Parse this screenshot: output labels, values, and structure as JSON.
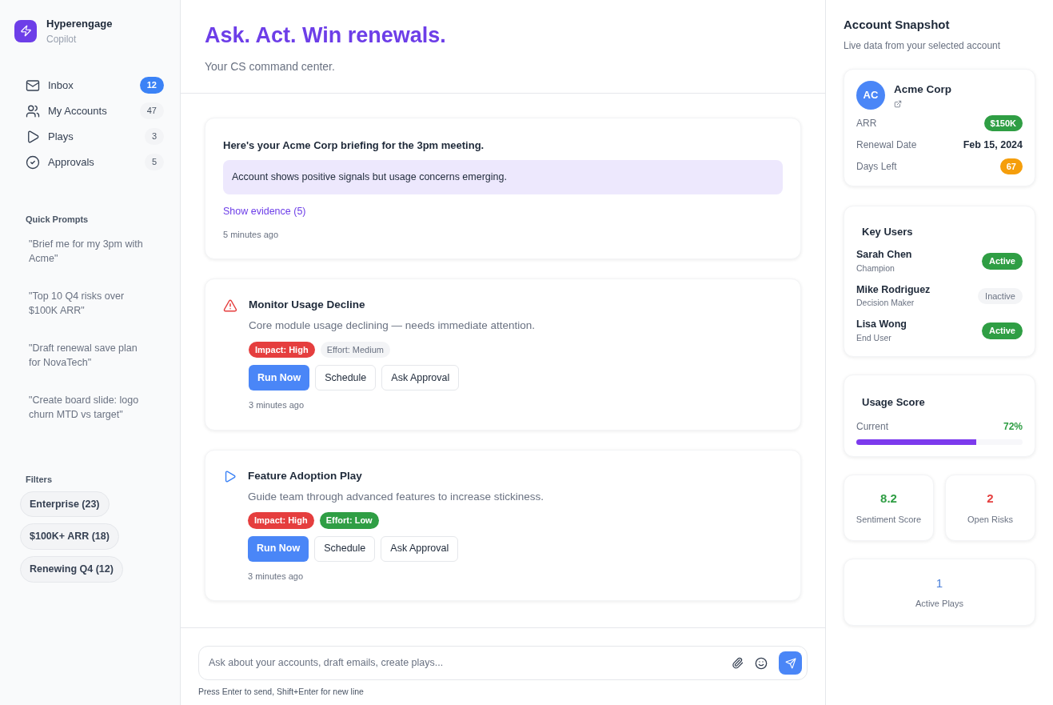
{
  "brand": {
    "name": "Hyperengage",
    "subtitle": "Copilot"
  },
  "nav": [
    {
      "label": "Inbox",
      "count": "12",
      "kind": "mail",
      "selected": true
    },
    {
      "label": "My Accounts",
      "count": "47",
      "kind": "users",
      "selected": false
    },
    {
      "label": "Plays",
      "count": "3",
      "kind": "play",
      "selected": false
    },
    {
      "label": "Approvals",
      "count": "5",
      "kind": "check",
      "selected": false
    }
  ],
  "quick_prompts": {
    "title": "Quick Prompts",
    "items": [
      "\"Brief me for my 3pm with Acme\"",
      "\"Top 10 Q4 risks over $100K ARR\"",
      "\"Draft renewal save plan for NovaTech\"",
      "\"Create board slide: logo churn MTD vs target\""
    ]
  },
  "filters": {
    "title": "Filters",
    "items": [
      "Enterprise (23)",
      "$100K+ ARR (18)",
      "Renewing Q4 (12)"
    ]
  },
  "header": {
    "title": "Ask. Act. Win renewals.",
    "subtitle": "Your CS command center."
  },
  "briefing": {
    "title": "Here's your Acme Corp briefing for the 3pm meeting.",
    "summary": "Account shows positive signals but usage concerns emerging.",
    "link": "Show evidence (5)",
    "time": "5 minutes ago"
  },
  "actions": [
    {
      "kind": "alert",
      "title": "Monitor Usage Decline",
      "description": "Core module usage declining — needs immediate attention.",
      "tags": [
        {
          "label": "Impact: High",
          "color": "#e53e3e"
        },
        {
          "label": "Effort: Medium",
          "color": "#f3f4f6"
        }
      ],
      "buttons": [
        "Run Now",
        "Schedule",
        "Ask Approval"
      ],
      "time": "3 minutes ago"
    },
    {
      "kind": "play",
      "title": "Feature Adoption Play",
      "description": "Guide team through advanced features to increase stickiness.",
      "tags": [
        {
          "label": "Impact: High",
          "color": "#e53e3e"
        },
        {
          "label": "Effort: Low",
          "color": "#2f9e44"
        }
      ],
      "buttons": [
        "Run Now",
        "Schedule",
        "Ask Approval"
      ],
      "time": "3 minutes ago"
    }
  ],
  "composer": {
    "placeholder": "Ask about your accounts, draft emails, create plays...",
    "hint": "Press Enter to send, Shift+Enter for new line"
  },
  "snapshot": {
    "title": "Account Snapshot",
    "subtitle": "Live data from your selected account",
    "account": {
      "initials": "AC",
      "name": "Acme Corp",
      "rows": [
        {
          "kind": "badge",
          "label": "ARR",
          "value": "$150K",
          "color": "#2f9e44"
        },
        {
          "kind": "text",
          "label": "Renewal Date",
          "value": "Feb 15, 2024"
        },
        {
          "kind": "badge",
          "label": "Days Left",
          "value": "67",
          "color": "#f59e0b"
        }
      ]
    },
    "key_users": {
      "title": "Key Users",
      "users": [
        {
          "name": "Sarah Chen",
          "role": "Champion",
          "status": "Active",
          "active": true
        },
        {
          "name": "Mike Rodriguez",
          "role": "Decision Maker",
          "status": "Inactive",
          "active": false
        },
        {
          "name": "Lisa Wong",
          "role": "End User",
          "status": "Active",
          "active": true
        }
      ]
    },
    "usage": {
      "title": "Usage Score",
      "label": "Current",
      "reading": "72%",
      "level": 0.72
    },
    "stats": [
      {
        "value": "8.2",
        "label": "Sentiment Score",
        "color": "#2f9e44"
      },
      {
        "value": "2",
        "label": "Open Risks",
        "color": "#e53e3e"
      }
    ],
    "active_plays": {
      "value": "1",
      "label": "Active Plays",
      "color": "#4a7fd9"
    }
  }
}
